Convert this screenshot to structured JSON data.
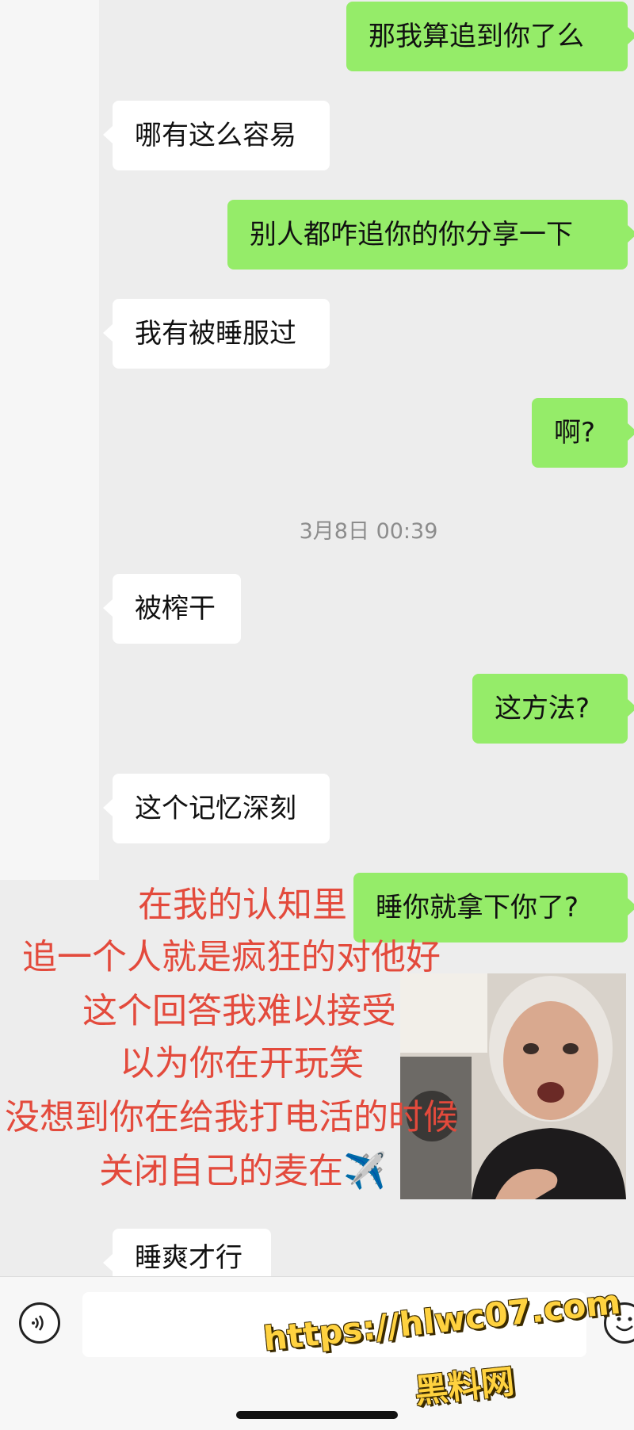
{
  "messages": [
    {
      "side": "out",
      "text": "那我算追到你了么"
    },
    {
      "side": "in",
      "text": "哪有这么容易"
    },
    {
      "side": "out",
      "text": "别人都咋追你的你分享一下"
    },
    {
      "side": "in",
      "text": "我有被睡服过"
    },
    {
      "side": "out",
      "text": "啊?"
    },
    {
      "side": "in",
      "text": "被榨干"
    },
    {
      "side": "out",
      "text": "这方法?"
    },
    {
      "side": "in",
      "text": "这个记忆深刻"
    },
    {
      "side": "out",
      "text": "睡你就拿下你了?"
    },
    {
      "side": "in",
      "text": "睡爽才行"
    }
  ],
  "timestamp": "3月8日 00:39",
  "overlay_lines": [
    "在我的认知里",
    "追一个人就是疯狂的对他好",
    "这个回答我难以接受",
    "以为你在开玩笑",
    "没想到你在给我打电活的时候",
    "关闭自己的麦在✈️"
  ],
  "watermark": {
    "url": "https://hlwc07.com",
    "site": "黑料网"
  },
  "icons": {
    "voice": "voice-icon",
    "emoji": "emoji-icon"
  },
  "colors": {
    "outgoing_bubble": "#95ec69",
    "incoming_bubble": "#ffffff",
    "overlay_text": "#e34a3c",
    "watermark": "#ffd23f"
  }
}
